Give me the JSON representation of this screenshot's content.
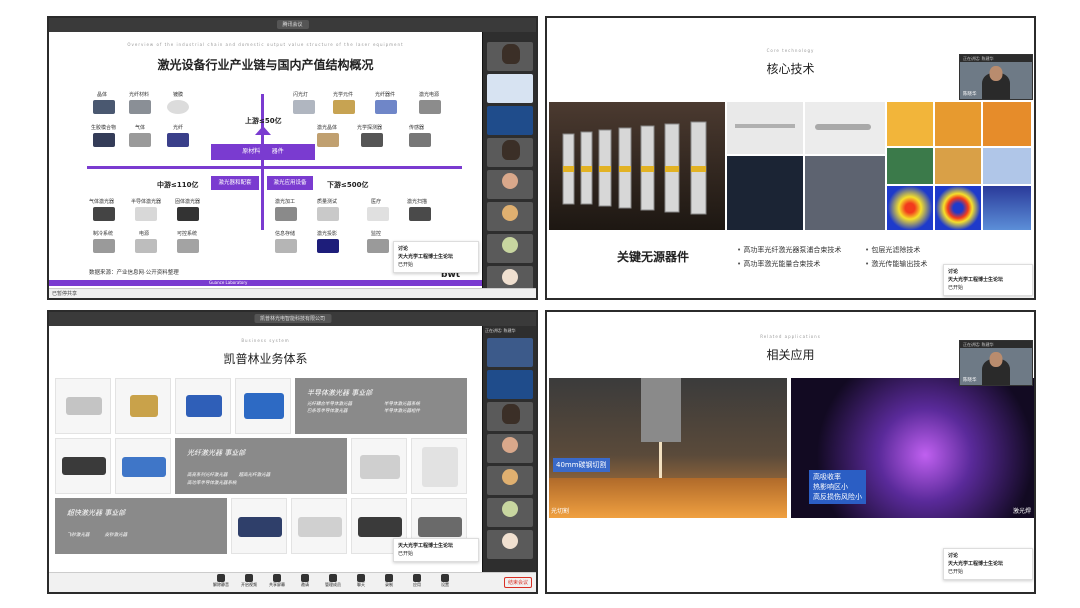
{
  "q1": {
    "window_title": "腾讯会议",
    "sub_en": "Overview of the industrial chain and domestic output value structure of the laser equipment",
    "title": "激光设备行业产业链与国内产值结构概况",
    "upstream": "上游≤50亿",
    "midstream": "中游≤110亿",
    "downstream": "下游≤500亿",
    "box_materials": "原材料",
    "box_devices": "器件",
    "box_laser": "激光器和配套",
    "box_apps": "激光应用设备",
    "up_left": [
      "晶体",
      "光纤材料",
      "镀膜",
      "生胶模合物",
      "气体",
      "光纤"
    ],
    "up_right": [
      "闪光灯",
      "光学元件",
      "光纤器件",
      "激光电源",
      "激光晶体",
      "光学探测器",
      "传感器"
    ],
    "mid_items": [
      "气体激光器",
      "半导体激光器",
      "固体激光器",
      "制冷系统",
      "电源",
      "可控系统"
    ],
    "down_items": [
      "激光加工",
      "质量测试",
      "医疗",
      "激光扫描",
      "信息存储",
      "激光投影",
      "监控"
    ],
    "source": "数据来源：产业信息网·公开资料整理",
    "footer": "Guance Laboratory",
    "logo": "bwt",
    "page_no": "18",
    "chat_header": "讨论",
    "chat_from": "天大光学工程博士生论坛",
    "chat_status": "已开始",
    "status_left": "已暂停共享"
  },
  "q2": {
    "sub_en": "Core technology",
    "title": "核心技术",
    "caption": "关键无源器件",
    "bullets": [
      "高功率光纤激光器泵浦合束技术",
      "高功率激光能量合束技术",
      "包层光滤除技术",
      "激光传能输出技术"
    ],
    "webcam_header": "正在讲话: 陈建华",
    "webcam_name": "陈晓华",
    "chat_header": "讨论",
    "chat_from": "天大光学工程博士生论坛",
    "chat_status": "已开始"
  },
  "q3": {
    "window_title": "凯普林光电智能科技有限公司",
    "sub_en": "Business system",
    "title": "凯普林业务体系",
    "dept1": {
      "h": "半导体激光器 事业部",
      "items": [
        "光纤耦合半导体激光器",
        "半导体激光器系统",
        "巴条等半导体激光器",
        "半导体激光器组件"
      ]
    },
    "dept2": {
      "h": "光纤激光器 事业部",
      "items": [
        "高亮系列光纤激光器",
        "超高光纤激光器",
        "高功率半导体激光器系统"
      ]
    },
    "dept3": {
      "h": "超快激光器 事业部",
      "items": [
        "飞秒激光器",
        "皮秒激光器"
      ]
    },
    "chat_from": "天大光学工程博士生论坛",
    "chat_status": "已开始",
    "toolbar": [
      "解除静音",
      "开启视频",
      "共享屏幕",
      "邀请",
      "管理成员",
      "聊天",
      "录制",
      "应用",
      "设置"
    ],
    "end_button": "结束会议",
    "webcam_header": "正在讲话: 陈建华"
  },
  "q4": {
    "sub_en": "Related applications",
    "title": "相关应用",
    "tag_left": "40mm碳钢切割",
    "caption_left": "光切割",
    "tag_right": [
      "高吸收率",
      "热影响区小",
      "高反损伤风险小"
    ],
    "caption_right": "激光焊",
    "webcam_header": "正在讲话: 陈建华",
    "webcam_name": "陈晓华",
    "chat_header": "讨论",
    "chat_from": "天大光学工程博士生论坛",
    "chat_status": "已开始"
  }
}
